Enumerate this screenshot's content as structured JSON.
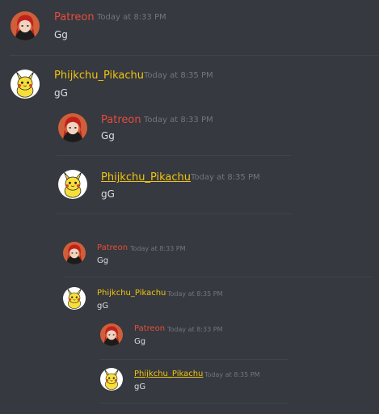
{
  "colors": {
    "background": "#36393f",
    "patreon_name": "#e74c3c",
    "pikachu_name": "#f1c40f",
    "timestamp": "#72767d",
    "message": "#dcddde"
  },
  "messages": [
    {
      "author": "Patreon",
      "timestamp": "Today at 8:33 PM",
      "text": "Gg",
      "avatar_icon": "red-haired-character-avatar"
    },
    {
      "author": "Phijkchu_Pikachu",
      "timestamp": "Today at 8:35 PM",
      "text": "gG",
      "avatar_icon": "pikachu-avatar"
    },
    {
      "author": "Patreon",
      "timestamp": "Today at 8:33 PM",
      "text": "Gg",
      "avatar_icon": "red-haired-character-avatar"
    },
    {
      "author": "Phijkchu_Pikachu",
      "timestamp": "Today at 8:35 PM",
      "text": "gG",
      "avatar_icon": "pikachu-avatar"
    },
    {
      "author": "Patreon",
      "timestamp": "Today at 8:33 PM",
      "text": "Gg",
      "avatar_icon": "red-haired-character-avatar"
    },
    {
      "author": "Phijkchu_Pikachu",
      "timestamp": "Today at 8:35 PM",
      "text": "gG",
      "avatar_icon": "pikachu-avatar"
    },
    {
      "author": "Patreon",
      "timestamp": "Today at 8:33 PM",
      "text": "Gg",
      "avatar_icon": "red-haired-character-avatar"
    },
    {
      "author": "Phijkchu_Pikachu",
      "timestamp": "Today at 8:35 PM",
      "text": "gG",
      "avatar_icon": "pikachu-avatar"
    }
  ]
}
